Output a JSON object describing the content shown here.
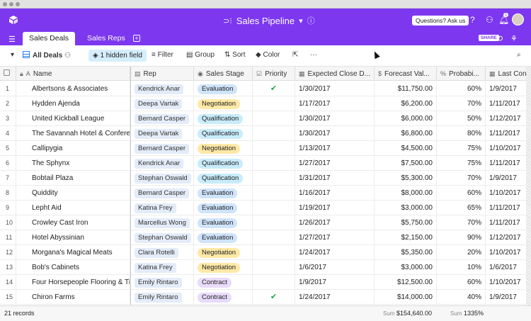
{
  "app": {
    "title": "Sales Pipeline",
    "help_label": "Questions? Ask us",
    "share_label": "SHARE",
    "notification_count": "1",
    "accent_color": "#7c37ef"
  },
  "tabs": [
    {
      "label": "Sales Deals",
      "active": true
    },
    {
      "label": "Sales Reps",
      "active": false
    }
  ],
  "toolbar": {
    "view_name": "All Deals",
    "hidden_fields": "1 hidden field",
    "filter": "Filter",
    "group": "Group",
    "sort": "Sort",
    "color": "Color",
    "more": "···"
  },
  "columns": [
    {
      "label": "Name",
      "icon": "A"
    },
    {
      "label": "Rep",
      "icon": "▤"
    },
    {
      "label": "Sales Stage",
      "icon": "◉"
    },
    {
      "label": "Priority",
      "icon": "☑"
    },
    {
      "label": "Expected Close D...",
      "icon": "▦"
    },
    {
      "label": "Forecast Val...",
      "icon": "$"
    },
    {
      "label": "Probabi...",
      "icon": "%"
    },
    {
      "label": "Last Contac",
      "icon": "▦"
    }
  ],
  "rows": [
    {
      "n": "1",
      "name": "Albertsons & Associates",
      "rep": "Kendrick Anar",
      "stage": "Evaluation",
      "priority": true,
      "close": "1/30/2017",
      "forecast": "$11,750.00",
      "prob": "60%",
      "last": "1/9/2017"
    },
    {
      "n": "2",
      "name": "Hydden Ajenda",
      "rep": "Deepa Vartak",
      "stage": "Negotiation",
      "priority": false,
      "close": "1/17/2017",
      "forecast": "$6,200.00",
      "prob": "70%",
      "last": "1/11/2017"
    },
    {
      "n": "3",
      "name": "United Kickball League",
      "rep": "Bernard Casper",
      "stage": "Qualification",
      "priority": false,
      "close": "1/30/2017",
      "forecast": "$6,000.00",
      "prob": "50%",
      "last": "1/12/2017"
    },
    {
      "n": "4",
      "name": "The Savannah Hotel & Confere...",
      "rep": "Deepa Vartak",
      "stage": "Qualification",
      "priority": false,
      "close": "1/30/2017",
      "forecast": "$6,800.00",
      "prob": "80%",
      "last": "1/11/2017"
    },
    {
      "n": "5",
      "name": "Callipygia",
      "rep": "Bernard Casper",
      "stage": "Negotiation",
      "priority": false,
      "close": "1/13/2017",
      "forecast": "$4,500.00",
      "prob": "75%",
      "last": "1/10/2017"
    },
    {
      "n": "6",
      "name": "The Sphynx",
      "rep": "Kendrick Anar",
      "stage": "Qualification",
      "priority": false,
      "close": "1/27/2017",
      "forecast": "$7,500.00",
      "prob": "75%",
      "last": "1/11/2017"
    },
    {
      "n": "7",
      "name": "Bobtail Plaza",
      "rep": "Stephan Oswald",
      "stage": "Qualification",
      "priority": false,
      "close": "1/31/2017",
      "forecast": "$5,300.00",
      "prob": "70%",
      "last": "1/9/2017"
    },
    {
      "n": "8",
      "name": "Quiddity",
      "rep": "Bernard Casper",
      "stage": "Evaluation",
      "priority": false,
      "close": "1/16/2017",
      "forecast": "$8,000.00",
      "prob": "60%",
      "last": "1/10/2017"
    },
    {
      "n": "9",
      "name": "Lepht Aid",
      "rep": "Katina Frey",
      "stage": "Evaluation",
      "priority": false,
      "close": "1/19/2017",
      "forecast": "$3,000.00",
      "prob": "65%",
      "last": "1/11/2017"
    },
    {
      "n": "10",
      "name": "Crowley Cast Iron",
      "rep": "Marcellus Wong",
      "stage": "Evaluation",
      "priority": false,
      "close": "1/26/2017",
      "forecast": "$5,750.00",
      "prob": "70%",
      "last": "1/11/2017"
    },
    {
      "n": "11",
      "name": "Hotel Abyssinian",
      "rep": "Stephan Oswald",
      "stage": "Evaluation",
      "priority": false,
      "close": "1/27/2017",
      "forecast": "$2,150.00",
      "prob": "90%",
      "last": "1/12/2017"
    },
    {
      "n": "12",
      "name": "Morgana's Magical Meats",
      "rep": "Clara Rotelli",
      "stage": "Negotiation",
      "priority": false,
      "close": "1/24/2017",
      "forecast": "$5,350.00",
      "prob": "20%",
      "last": "1/10/2017"
    },
    {
      "n": "13",
      "name": "Bob's Cabinets",
      "rep": "Katina Frey",
      "stage": "Negotiation",
      "priority": false,
      "close": "1/6/2017",
      "forecast": "$3,000.00",
      "prob": "10%",
      "last": "1/6/2017"
    },
    {
      "n": "14",
      "name": "Four Horsepeople Flooring & Ti...",
      "rep": "Emily Rintaro",
      "stage": "Contract",
      "priority": false,
      "close": "1/9/2017",
      "forecast": "$12,500.00",
      "prob": "60%",
      "last": "1/10/2017"
    },
    {
      "n": "15",
      "name": "Chiron Farms",
      "rep": "Emily Rintaro",
      "stage": "Contract",
      "priority": true,
      "close": "1/24/2017",
      "forecast": "$14,000.00",
      "prob": "40%",
      "last": "1/9/2017"
    }
  ],
  "stage_colors": {
    "Evaluation": "#cfe4fb",
    "Negotiation": "#ffe9a6",
    "Qualification": "#c8ecfb",
    "Contract": "#e8dbfb"
  },
  "footer": {
    "record_count": "21 records",
    "sum_label": "Sum",
    "forecast_sum": "$154,640.00",
    "prob_sum": "1335%"
  }
}
